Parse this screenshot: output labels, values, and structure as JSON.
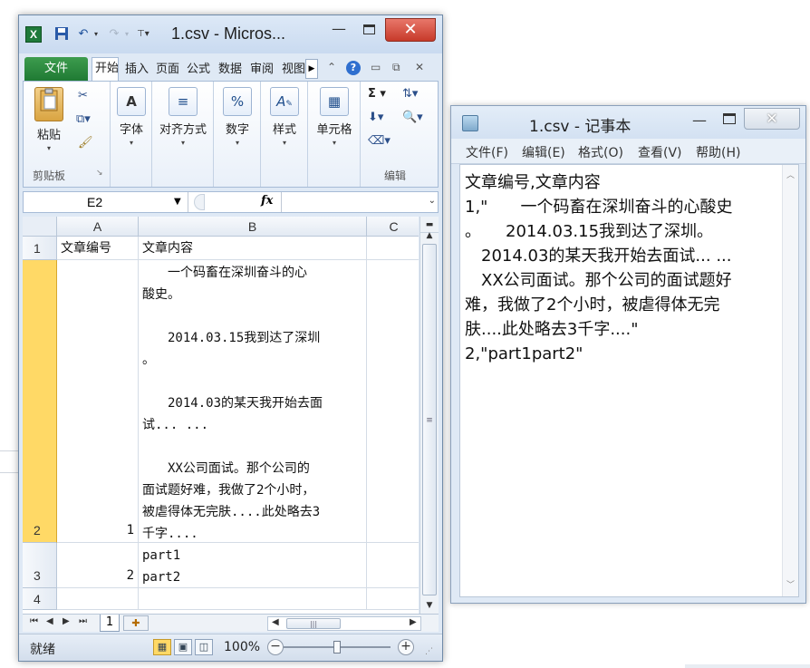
{
  "excel": {
    "title": "1.csv - Micros...",
    "app_icon": "X",
    "qat_icons": [
      "save-icon",
      "undo-icon",
      "redo-icon",
      "customize-qat-icon"
    ],
    "tabs": {
      "file": "文件",
      "items": [
        "开始",
        "插入",
        "页面",
        "公式",
        "数据",
        "审阅",
        "视图"
      ]
    },
    "ribbon": {
      "paste": "粘贴",
      "clipboard_group": "剪贴板",
      "font": "字体",
      "alignment": "对齐方式",
      "number": "数字",
      "styles": "样式",
      "cells": "单元格",
      "editing_group": "编辑",
      "font_icon_glyph": "A",
      "number_icon_glyph": "%",
      "sigma_glyph": "Σ"
    },
    "namebox": "E2",
    "fx": "fx",
    "columns": [
      "A",
      "B",
      "C"
    ],
    "rows": [
      {
        "num": "1",
        "a": "文章编号",
        "b": "文章内容",
        "c": ""
      },
      {
        "num": "2",
        "a": "1",
        "b": "　　一个码畜在深圳奋斗的心\n酸史。\n\n　　2014.03.15我到达了深圳\n。\n\n　　2014.03的某天我开始去面\n试... ...\n\n　　XX公司面试。那个公司的\n面试题好难，我做了2个小时，\n被虐得体无完肤....此处略去3\n千字....",
        "c": ""
      },
      {
        "num": "3",
        "a": "2",
        "b": "part1\npart2",
        "c": ""
      },
      {
        "num": "4",
        "a": "",
        "b": "",
        "c": ""
      }
    ],
    "sheet_tab": "1",
    "status": "就绪",
    "zoom": "100%",
    "zoom_percent": 100
  },
  "notepad": {
    "title": "1.csv - 记事本",
    "menu": [
      "文件(F)",
      "编辑(E)",
      "格式(O)",
      "查看(V)",
      "帮助(H)"
    ],
    "content": "文章编号,文章内容\n1,\"　　一个码畜在深圳奋斗的心酸史\n。　　2014.03.15我到达了深圳。\n　2014.03的某天我开始去面试... ...\n　XX公司面试。那个公司的面试题好\n难，我做了2个小时，被虐得体无完\n肤....此处略去3千字....\"\n2,\"part1part2\""
  },
  "colors": {
    "excel_green": "#1f7a34",
    "close_red": "#c73a2a",
    "selected_row_header": "#ffd966"
  }
}
